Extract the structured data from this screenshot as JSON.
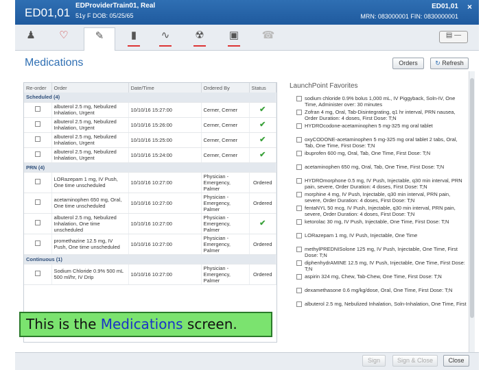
{
  "header": {
    "room": "ED01,01",
    "patient_name": "EDProviderTrain01, Real",
    "patient_info": "51y   F   DOB: 05/25/65",
    "room_right": "ED01,01",
    "ids": "MRN: 083000001   FIN: 0830000001",
    "close": "×"
  },
  "toolbar": {
    "icons": [
      "person-icon",
      "heart-icon",
      "pill-icon",
      "thermometer-icon",
      "waveform-icon",
      "radiation-icon",
      "kit-icon",
      "phone-icon"
    ]
  },
  "page": {
    "title": "Medications",
    "orders_btn": "Orders",
    "refresh_btn": "Refresh"
  },
  "grid": {
    "headers": [
      "Re-order",
      "Order",
      "Date/Time",
      "Ordered By",
      "Status"
    ],
    "groups": [
      {
        "label": "Scheduled (4)",
        "rows": [
          {
            "order": "albuterol 2.5 mg, Nebulized Inhalation, Urgent",
            "date": "10/10/16 15:27:00",
            "by": "Cerner, Cerner",
            "status": "✔"
          },
          {
            "order": "albuterol 2.5 mg, Nebulized Inhalation, Urgent",
            "date": "10/10/16 15:26:00",
            "by": "Cerner, Cerner",
            "status": "✔"
          },
          {
            "order": "albuterol 2.5 mg, Nebulized Inhalation, Urgent",
            "date": "10/10/16 15:25:00",
            "by": "Cerner, Cerner",
            "status": "✔"
          },
          {
            "order": "albuterol 2.5 mg, Nebulized Inhalation, Urgent",
            "date": "10/10/16 15:24:00",
            "by": "Cerner, Cerner",
            "status": "✔"
          }
        ]
      },
      {
        "label": "PRN (4)",
        "rows": [
          {
            "order": "LORazepam 1 mg, IV Push, One time unscheduled",
            "date": "10/10/16 10:27:00",
            "by": "Physician - Emergency, Palmer",
            "status": "Ordered"
          },
          {
            "order": "acetaminophen 650 mg, Oral, One time unscheduled",
            "date": "10/10/16 10:27:00",
            "by": "Physician - Emergency, Palmer",
            "status": "Ordered"
          },
          {
            "order": "albuterol 2.5 mg, Nebulized Inhalation, One time unscheduled",
            "date": "10/10/16 10:27:00",
            "by": "Physician - Emergency, Palmer",
            "status": "✔"
          },
          {
            "order": "promethazine 12.5 mg, IV Push, One time unscheduled",
            "date": "10/10/16 10:27:00",
            "by": "Physician - Emergency, Palmer",
            "status": "Ordered"
          }
        ]
      },
      {
        "label": "Continuous (1)",
        "rows": [
          {
            "order": "Sodium Chloride 0.9% 500 mL 500 ml/hr, IV Drip",
            "date": "10/10/16 10:27:00",
            "by": "Physician - Emergency, Palmer",
            "status": "Ordered"
          }
        ]
      }
    ]
  },
  "launchpoint": {
    "title": "LaunchPoint Favorites",
    "items": [
      "sodium chloride 0.9% bolus 1,000 mL, IV Piggyback, Soln-IV, One Time, Administer over: 30 minutes",
      "Zofran 4 mg, Oral, Tab-Disintegrating, q1 hr interval, PRN nausea, Order Duration: 4 doses, First Dose: T;N",
      "HYDROcodone-acetaminophen 5 mg-325 mg oral tablet",
      "oxyCODONE-acetaminophen 5 mg-325 mg oral tablet 2 tabs, Oral, Tab, One Time, First Dose: T;N",
      "ibuprofen 600 mg, Oral, Tab, One Time, First Dose: T;N",
      "acetaminophen 650 mg, Oral, Tab, One Time, First Dose: T;N",
      "HYDROmorphone 0.5 mg, IV Push, Injectable, q30 min interval, PRN pain, severe, Order Duration: 4 doses, First Dose: T;N",
      "morphine 4 mg, IV Push, Injectable, q30 min interval, PRN pain, severe, Order Duration: 4 doses, First Dose: T;N",
      "fentaNYL 50 mcg, IV Push, Injectable, q30 min interval, PRN pain, severe, Order Duration: 4 doses, First Dose: T;N",
      "ketorolac 30 mg, IV Push, Injectable, One Time, First Dose: T;N",
      "LORazepam 1 mg, IV Push, Injectable, One Time",
      "methylPREDNISolone 125 mg, IV Push, Injectable, One Time, First Dose: T;N",
      "diphenhydrAMINE 12.5 mg, IV Push, Injectable, One Time, First Dose: T;N",
      "aspirin 324 mg, Chew, Tab-Chew, One Time, First Dose: T;N",
      "dexamethasone 0.6 mg/kg/dose, Oral, One Time, First Dose: T;N",
      "albuterol 2.5 mg, Nebulized Inhalation, Soln-Inhalation, One Time, First"
    ]
  },
  "footer": {
    "sign": "Sign",
    "sign_close": "Sign & Close",
    "close": "Close"
  },
  "caption": {
    "before": "This is the ",
    "highlight": "Medications",
    "after": " screen."
  }
}
